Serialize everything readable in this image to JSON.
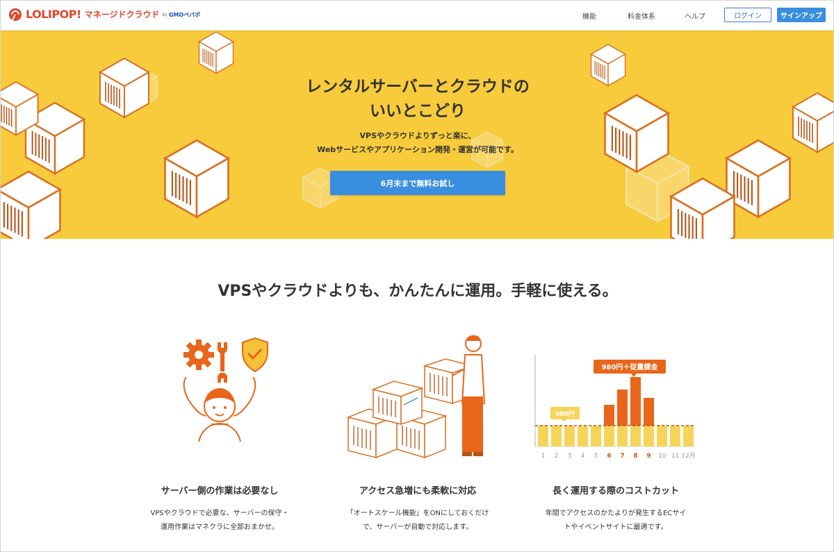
{
  "header": {
    "brand": "LOLIPOP!",
    "product": "マネージドクラウド",
    "by": "by",
    "company": "GMOペパボ",
    "nav": [
      "機能",
      "料金体系",
      "ヘルプ"
    ],
    "login_label": "ログイン",
    "signup_label": "サインアップ"
  },
  "hero": {
    "title_line1": "レンタルサーバーとクラウドの",
    "title_line2": "いいとこどり",
    "sub_line1": "VPSやクラウドよりずっと楽に、",
    "sub_line2": "Webサービスやアプリケーション開発・運営が可能です。",
    "cta_label": "6月末まで無料お試し"
  },
  "features": {
    "title": "VPSやクラウドよりも、かんたんに運用。手軽に使える。",
    "items": [
      {
        "title": "サーバー側の作業は必要なし",
        "line1": "VPSやクラウドで必要な、サーバーの保守・",
        "line2": "運用作業はマネクラに全部おまかせ。"
      },
      {
        "title": "アクセス急増にも柔軟に対応",
        "line1": "「オートスケール機能」をONにしておくだけ",
        "line2": "で、サーバーが自動で対応します。"
      },
      {
        "title": "長く運用する際のコストカット",
        "line1": "年間でアクセスのかたよりが発生するECサイ",
        "line2": "トやイベントサイトに最適です。"
      }
    ]
  },
  "chart": {
    "base_label": "980円",
    "peak_label": "980円＋従量課金",
    "months": [
      "1",
      "2",
      "3",
      "4",
      "5",
      "6",
      "7",
      "8",
      "9",
      "10",
      "11",
      "12月"
    ],
    "highlight_months": [
      "6",
      "7",
      "8",
      "9"
    ]
  },
  "colors": {
    "brand_red": "#e0452b",
    "hero_yellow": "#f7cb3b",
    "accent_blue": "#3a8ee0",
    "illustration_orange": "#e8651a"
  }
}
